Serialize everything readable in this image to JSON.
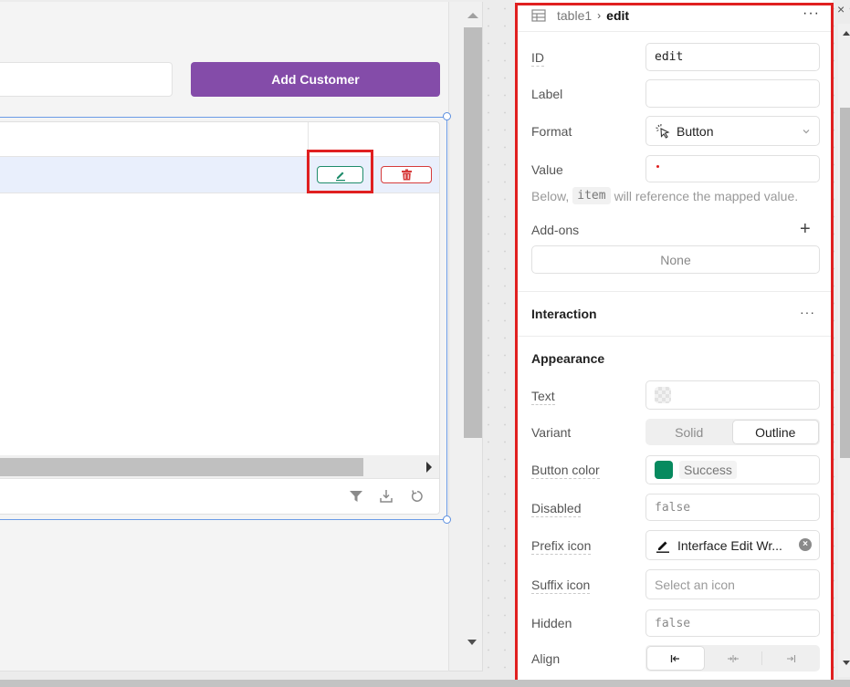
{
  "app": {
    "add_customer_label": "Add Customer",
    "accent_color": "#844ca9"
  },
  "table": {
    "row_actions": [
      {
        "name": "edit",
        "icon": "pencil-icon",
        "color": "#1e8c6b"
      },
      {
        "name": "delete",
        "icon": "trash-icon",
        "color": "#d63b3b"
      }
    ],
    "toolbar": [
      "filter-icon",
      "download-icon",
      "refresh-icon"
    ]
  },
  "inspector": {
    "breadcrumb_parent": "table1",
    "breadcrumb_separator": "›",
    "breadcrumb_current": "edit",
    "more_label": "···",
    "fields": {
      "id_label": "ID",
      "id_value": "edit",
      "label_label": "Label",
      "label_value": "",
      "format_label": "Format",
      "format_value": "Button",
      "value_label": "Value",
      "value_value": "",
      "helper_prefix": "Below,",
      "helper_code": "item",
      "helper_suffix": "will reference the mapped value.",
      "addons_label": "Add-ons",
      "addons_value": "None"
    },
    "interaction": {
      "title": "Interaction",
      "more_label": "···"
    },
    "appearance": {
      "title": "Appearance",
      "text_label": "Text",
      "variant_label": "Variant",
      "variant_options": [
        "Solid",
        "Outline"
      ],
      "variant_selected": "Outline",
      "button_color_label": "Button color",
      "button_color_value": "Success",
      "button_color_hex": "#078a5f",
      "disabled_label": "Disabled",
      "disabled_value": "false",
      "prefix_icon_label": "Prefix icon",
      "prefix_icon_value": "Interface Edit Wr...",
      "suffix_icon_label": "Suffix icon",
      "suffix_icon_placeholder": "Select an icon",
      "hidden_label": "Hidden",
      "hidden_value": "false",
      "align_label": "Align",
      "align_options": [
        "left",
        "center",
        "right"
      ],
      "align_selected": "left"
    },
    "close_label": "×"
  }
}
